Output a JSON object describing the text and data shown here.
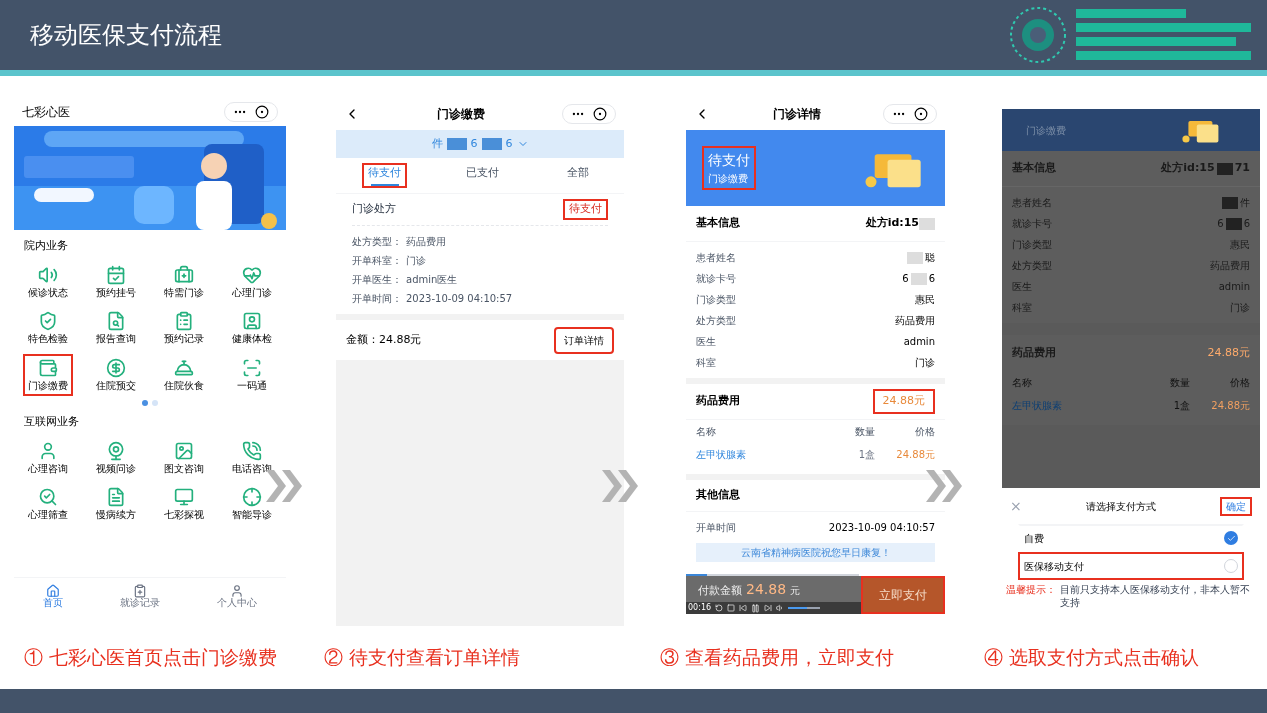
{
  "slide": {
    "title": "移动医保支付流程"
  },
  "phone_home": {
    "app_title": "七彩心医",
    "sections": [
      {
        "title": "院内业务",
        "items": [
          {
            "label": "候诊状态",
            "highlighted": false
          },
          {
            "label": "预约挂号",
            "highlighted": false
          },
          {
            "label": "特需门诊",
            "highlighted": false
          },
          {
            "label": "心理门诊",
            "highlighted": false
          },
          {
            "label": "特色检验",
            "highlighted": false
          },
          {
            "label": "报告查询",
            "highlighted": false
          },
          {
            "label": "预约记录",
            "highlighted": false
          },
          {
            "label": "健康体检",
            "highlighted": false
          },
          {
            "label": "门诊缴费",
            "highlighted": true
          },
          {
            "label": "住院预交",
            "highlighted": false
          },
          {
            "label": "住院伙食",
            "highlighted": false
          },
          {
            "label": "一码通",
            "highlighted": false
          }
        ],
        "pager": [
          {
            "selected": true
          },
          {
            "selected": false
          }
        ]
      },
      {
        "title": "互联网业务",
        "items": [
          {
            "label": "心理咨询",
            "highlighted": false
          },
          {
            "label": "视频问诊",
            "highlighted": false
          },
          {
            "label": "图文咨询",
            "highlighted": false
          },
          {
            "label": "电话咨询",
            "highlighted": false
          },
          {
            "label": "心理筛查",
            "highlighted": false
          },
          {
            "label": "慢病续方",
            "highlighted": false
          },
          {
            "label": "七彩探视",
            "highlighted": false
          },
          {
            "label": "智能导诊",
            "highlighted": false
          }
        ]
      }
    ],
    "tabs": [
      {
        "label": "首页",
        "selected": true
      },
      {
        "label": "就诊记录",
        "selected": false
      },
      {
        "label": "个人中心",
        "selected": false
      }
    ]
  },
  "phone_orders": {
    "title": "门诊缴费",
    "patient_parts": [
      "件",
      "6",
      "6"
    ],
    "tabs": [
      {
        "label": "待支付",
        "selected": true,
        "highlighted": true
      },
      {
        "label": "已支付",
        "selected": false,
        "highlighted": false
      },
      {
        "label": "全部",
        "selected": false,
        "highlighted": false
      }
    ],
    "order": {
      "title": "门诊处方",
      "status": "待支付",
      "status_highlighted": true,
      "fields": [
        {
          "label": "处方类型：",
          "value": "药品费用"
        },
        {
          "label": "开单科室：",
          "value": "门诊"
        },
        {
          "label": "开单医生：",
          "value": "admin医生"
        },
        {
          "label": "开单时间：",
          "value": "2023-10-09 04:10:57"
        }
      ],
      "amount": "金额：24.88元",
      "button": "订单详情",
      "button_highlighted": true
    }
  },
  "phone_detail": {
    "title": "门诊详情",
    "status": "待支付",
    "subtitle": "门诊缴费",
    "status_highlighted": true,
    "basic_title": "基本信息",
    "prescription_id": "处方id:15",
    "rows": [
      {
        "label": "患者姓名",
        "value": "聪",
        "masked": true
      },
      {
        "label": "就诊卡号",
        "value_parts": [
          "6",
          "6"
        ],
        "masked": true
      },
      {
        "label": "门诊类型",
        "value": "惠民",
        "masked": false
      },
      {
        "label": "处方类型",
        "value": "药品费用",
        "masked": false
      },
      {
        "label": "医生",
        "value": "admin",
        "masked": false
      },
      {
        "label": "科室",
        "value": "门诊",
        "masked": false
      }
    ],
    "fee_title": "药品费用",
    "fee_total": "24.88元",
    "fee_highlighted": true,
    "columns": [
      "名称",
      "数量",
      "价格"
    ],
    "drugs": [
      {
        "name": "左甲状腺素",
        "qty": "1盒",
        "price": "24.88元"
      }
    ],
    "other_title": "其他信息",
    "other_rows": [
      {
        "label": "开单时间",
        "value": "2023-10-09 04:10:57"
      }
    ],
    "wish": "云南省精神病医院祝您早日康复！",
    "pay_label": "付款金额",
    "pay_amount": "24.88",
    "pay_unit": "元",
    "pay_button": "立即支付",
    "pay_highlighted": true,
    "player": {
      "time": "00:16",
      "level": 0.12,
      "volume": {
        "level": 0.6
      }
    }
  },
  "phone_pay": {
    "header": "门诊缴费",
    "basic_title": "基本信息",
    "prescription_id_parts": [
      "处方id:15",
      "71"
    ],
    "rows": [
      {
        "label": "患者姓名",
        "value_parts": [
          "件"
        ],
        "masked": true
      },
      {
        "label": "就诊卡号",
        "value_parts": [
          "6",
          "6"
        ],
        "masked": true
      },
      {
        "label": "门诊类型",
        "value_parts": [
          "惠民"
        ],
        "masked": false
      },
      {
        "label": "处方类型",
        "value_parts": [
          "药品费用"
        ],
        "masked": false
      },
      {
        "label": "医生",
        "value_parts": [
          "admin"
        ],
        "masked": false
      },
      {
        "label": "科室",
        "value_parts": [
          "门诊"
        ],
        "masked": false
      }
    ],
    "fee_title": "药品费用",
    "fee_total": "24.88元",
    "columns": [
      "名称",
      "数量",
      "价格"
    ],
    "drugs": [
      {
        "name": "左甲状腺素",
        "qty": "1盒",
        "price": "24.88元"
      }
    ],
    "sheet": {
      "close": "×",
      "title": "请选择支付方式",
      "confirm": "确定",
      "confirm_highlighted": true,
      "options": [
        {
          "label": "自费",
          "selected": true,
          "highlighted": false
        },
        {
          "label": "医保移动支付",
          "selected": false,
          "highlighted": true
        }
      ],
      "notice_label": "温馨提示：",
      "notice": "目前只支持本人医保移动支付，非本人暂不支持"
    }
  },
  "captions": [
    "① 七彩心医首页点击门诊缴费",
    "② 待支付查看订单详情",
    "③ 查看药品费用，立即支付",
    "④ 选取支付方式点击确认"
  ]
}
